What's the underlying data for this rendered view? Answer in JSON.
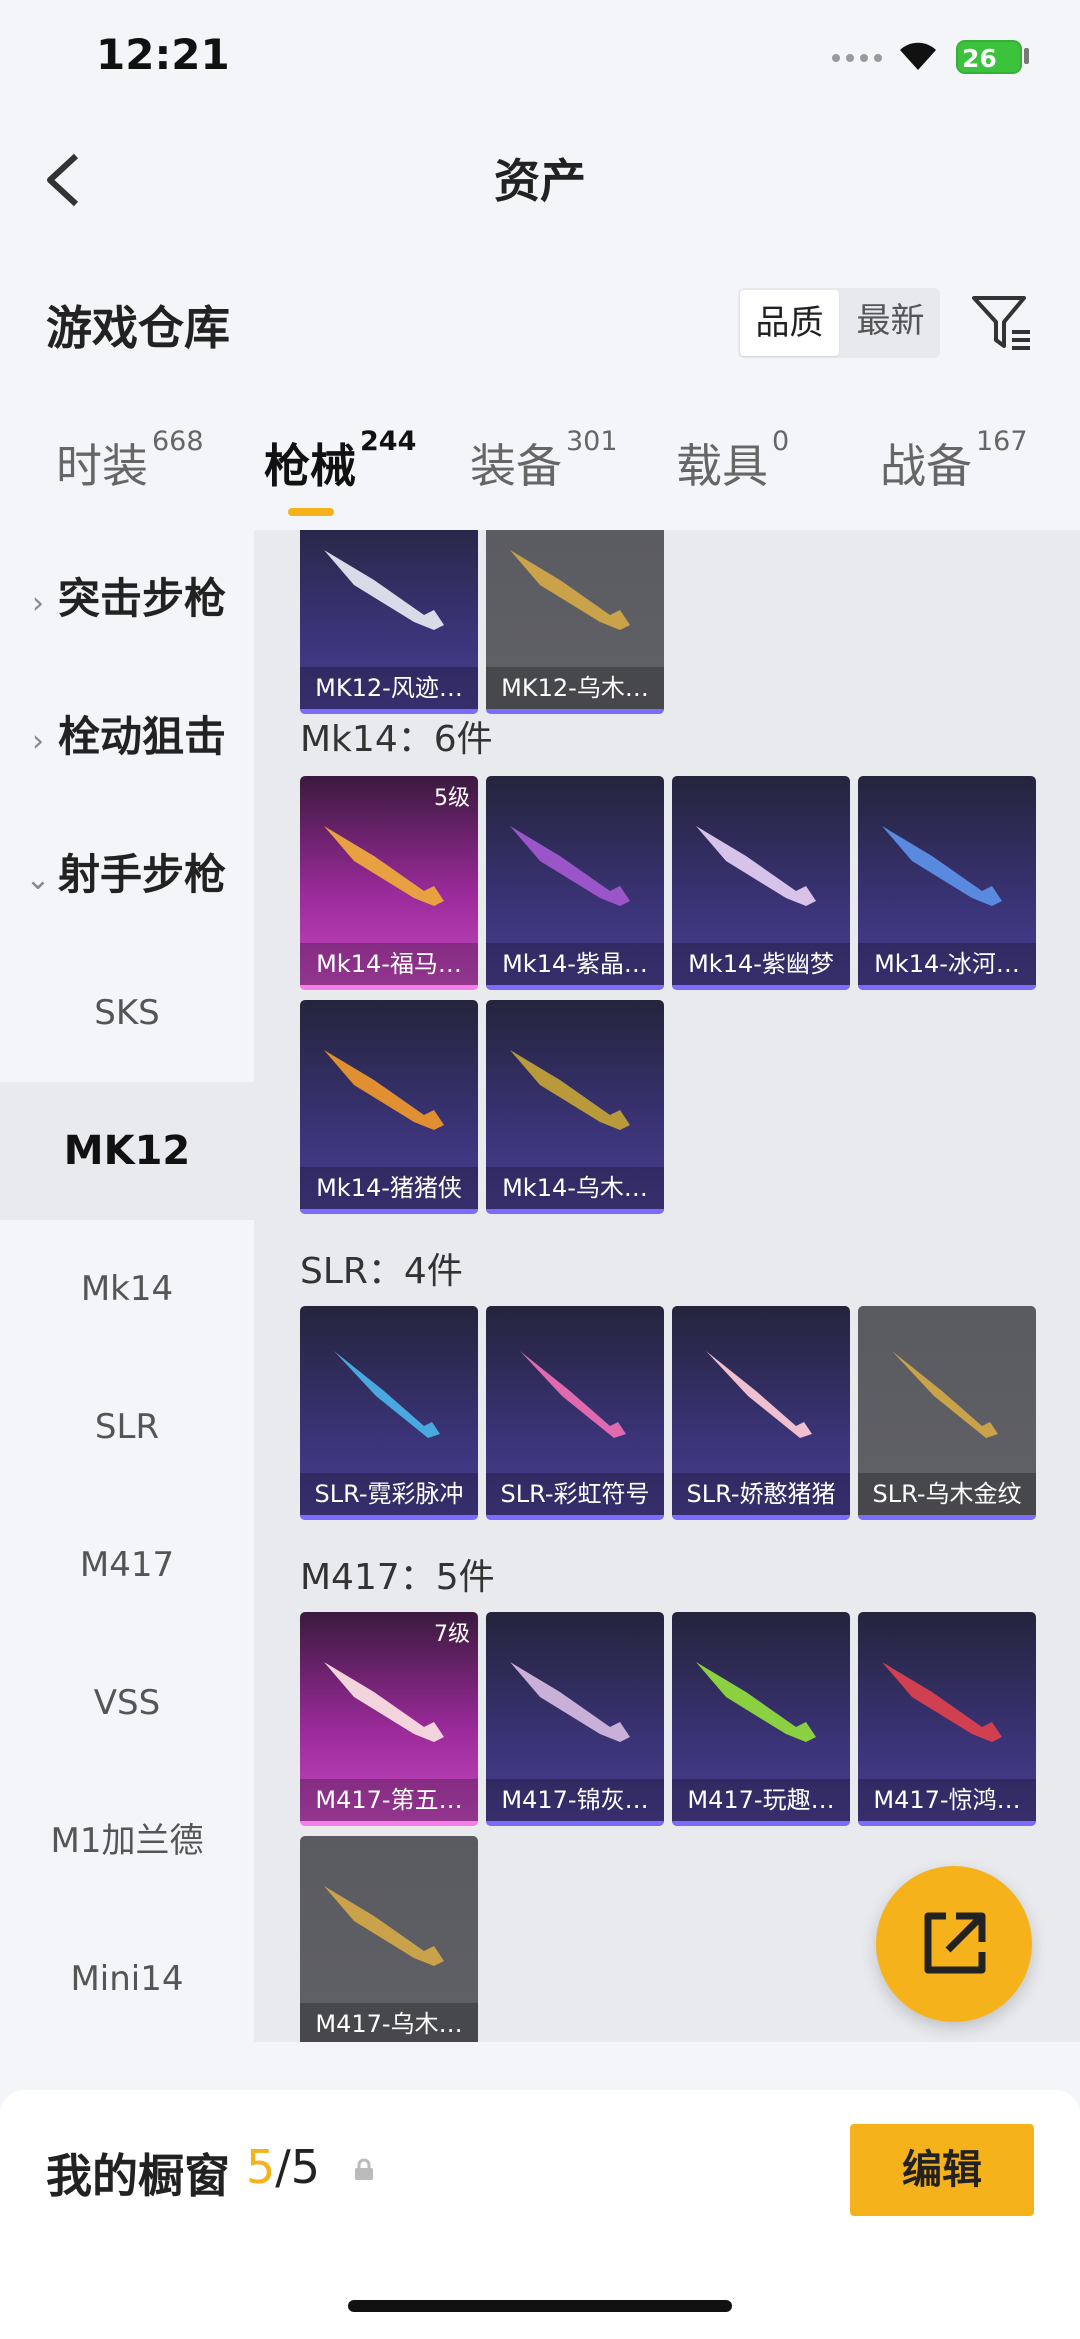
{
  "status": {
    "time": "12:21",
    "battery": "26"
  },
  "header": {
    "title": "资产"
  },
  "section": {
    "title": "游戏仓库",
    "sort_options": [
      "品质",
      "最新"
    ]
  },
  "tabs": [
    {
      "label": "时装",
      "count": "668"
    },
    {
      "label": "枪械",
      "count": "244"
    },
    {
      "label": "装备",
      "count": "301"
    },
    {
      "label": "载具",
      "count": "0"
    },
    {
      "label": "战备",
      "count": "167"
    }
  ],
  "sidebar": {
    "categories": [
      {
        "label": "突击步枪",
        "chevron": "›"
      },
      {
        "label": "栓动狙击",
        "chevron": "›"
      },
      {
        "label": "射手步枪",
        "chevron": "⌄"
      }
    ],
    "items": [
      "SKS",
      "MK12",
      "Mk14",
      "SLR",
      "M417",
      "VSS",
      "M1加兰德",
      "Mini14"
    ]
  },
  "content": {
    "top_cards": [
      {
        "name": "MK12-风迹…",
        "style": "purple"
      },
      {
        "name": "MK12-乌木…",
        "style": "gray"
      }
    ],
    "groups": [
      {
        "title": "Mk14：6件",
        "cards": [
          {
            "name": "Mk14-福马…",
            "style": "pink",
            "level": "5级"
          },
          {
            "name": "Mk14-紫晶…",
            "style": "purple"
          },
          {
            "name": "Mk14-紫幽梦",
            "style": "purple"
          },
          {
            "name": "Mk14-冰河…",
            "style": "purple"
          },
          {
            "name": "Mk14-猪猪侠",
            "style": "purple"
          },
          {
            "name": "Mk14-乌木…",
            "style": "purple"
          }
        ]
      },
      {
        "title": "SLR：4件",
        "cards": [
          {
            "name": "SLR-霓彩脉冲",
            "style": "purple"
          },
          {
            "name": "SLR-彩虹符号",
            "style": "purple"
          },
          {
            "name": "SLR-娇憨猪猪",
            "style": "purple"
          },
          {
            "name": "SLR-乌木金纹",
            "style": "gray"
          }
        ]
      },
      {
        "title": "M417：5件",
        "cards": [
          {
            "name": "M417-第五…",
            "style": "pink",
            "level": "7级"
          },
          {
            "name": "M417-锦灰…",
            "style": "purple"
          },
          {
            "name": "M417-玩趣…",
            "style": "purple"
          },
          {
            "name": "M417-惊鸿…",
            "style": "purple"
          },
          {
            "name": "M417-乌木…",
            "style": "gray"
          }
        ]
      }
    ]
  },
  "showcase": {
    "label": "我的橱窗",
    "used": "5",
    "total": "/5"
  },
  "actions": {
    "edit": "编辑"
  },
  "colors": {
    "accent": "#f6b21a",
    "card_purple": "#3a3376",
    "card_pink": "#c64ac1",
    "card_gray": "#5a5b60"
  }
}
